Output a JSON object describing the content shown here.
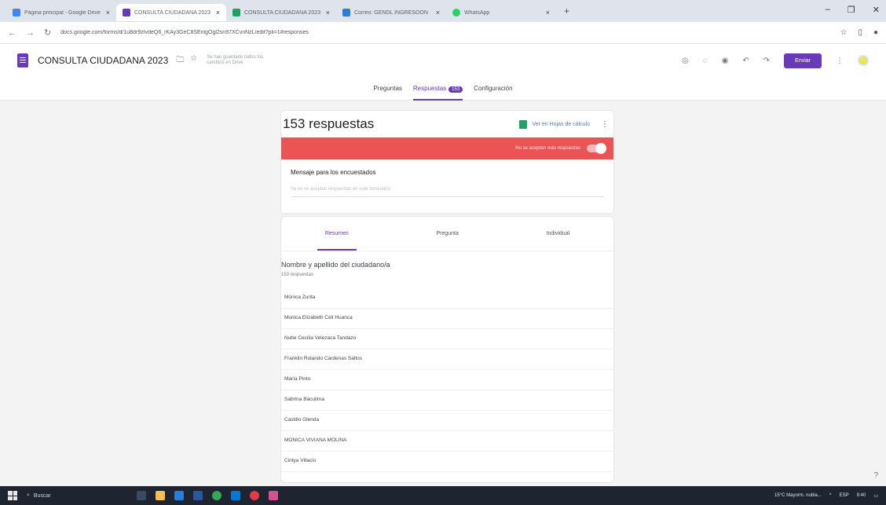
{
  "browser": {
    "tabs": [
      {
        "title": "Página principal - Google Drive",
        "color": "#4285f4"
      },
      {
        "title": "CONSULTA CIUDADANA 2023",
        "color": "#673ab7",
        "active": true
      },
      {
        "title": "CONSULTA CIUDADANA 2023",
        "color": "#1ea362"
      },
      {
        "title": "Correo: GENDL INGRESOON",
        "color": "#2b7cd3"
      },
      {
        "title": "WhatsApp",
        "color": "#25d366"
      }
    ],
    "url": "docs.google.com/forms/d/1u8dr9zIvdeQ6_rKAy3GeC8SEnlgOgl2sn97XCvnNzL/edit?pli=1#responses"
  },
  "form": {
    "title": "CONSULTA CIUDADANA 2023",
    "saved_status": "Se han guardado todos los cambios en Drive",
    "send_label": "Enviar",
    "tabs": {
      "questions": "Preguntas",
      "responses": "Respuestas",
      "responses_badge": "153",
      "settings": "Configuración"
    }
  },
  "responses": {
    "count_title": "153 respuestas",
    "sheets_link": "Ver en Hojas de cálculo",
    "accepting_label": "No se aceptan más respuestas",
    "message_label": "Mensaje para los encuestados",
    "message_placeholder": "Ya no se aceptan respuestas en este formulario"
  },
  "subtabs": {
    "summary": "Resumen",
    "question": "Pregunta",
    "individual": "Individual"
  },
  "question": {
    "title": "Nombre y apellido del ciudadano/a",
    "count": "153 respuestas",
    "answers": [
      "Mónica Zurita",
      "Monica Elizabeth Celi Huanca",
      "Nube Cecilia Velezaca Tandazo",
      "Franklin Rolando Cárdenas Saltos",
      "María Pinto",
      "Sabrina Baculima",
      "Castillo Glenda",
      "MONICA VIVIANA MOLINA",
      "Cintya Villacis"
    ]
  },
  "taskbar": {
    "search": "Buscar",
    "weather": "15°C Mayorm. nubla...",
    "lang": "ESP",
    "clock": "9:40"
  }
}
